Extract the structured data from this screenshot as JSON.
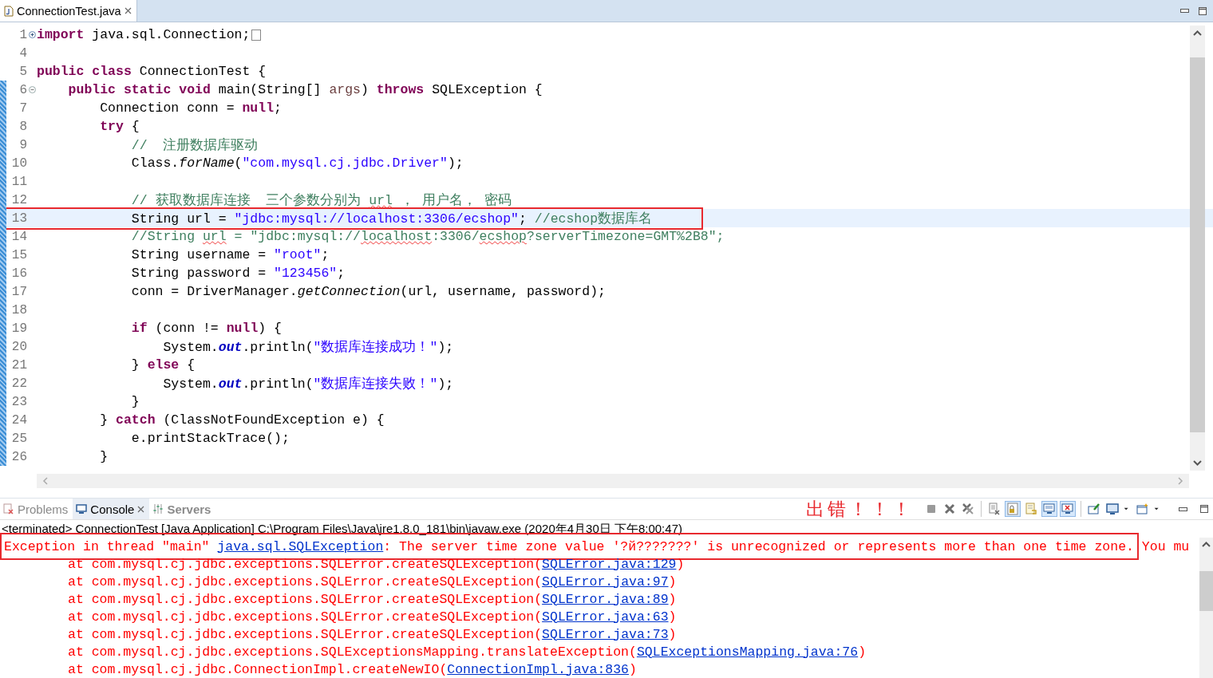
{
  "editor": {
    "tab": {
      "title": "ConnectionTest.java",
      "selected": true
    },
    "lines": [
      {
        "number": "1",
        "expanded": false,
        "folded_box": true,
        "scope": false,
        "current": false,
        "boxed": false,
        "segments": [
          {
            "kind": "keyword",
            "text": "import"
          },
          {
            "kind": "plain",
            "text": " java.sql.Connection;"
          }
        ]
      },
      {
        "number": "4",
        "scope": false,
        "current": false,
        "boxed": false
      },
      {
        "number": "5",
        "scope": false,
        "current": false,
        "boxed": false,
        "segments": [
          {
            "kind": "keyword",
            "text": "public class"
          },
          {
            "kind": "plain",
            "text": " ConnectionTest {"
          }
        ]
      },
      {
        "number": "6",
        "expanded": true,
        "scope": true,
        "current": false,
        "boxed": false,
        "segments": [
          {
            "kind": "keyword",
            "text": "    public static void"
          },
          {
            "kind": "plain",
            "text": " main(String[] "
          },
          {
            "kind": "param",
            "text": "args"
          },
          {
            "kind": "plain",
            "text": ") "
          },
          {
            "kind": "keyword",
            "text": "throws"
          },
          {
            "kind": "plain",
            "text": " SQLException {"
          }
        ]
      },
      {
        "number": "7",
        "scope": true,
        "current": false,
        "boxed": false,
        "segments": [
          {
            "kind": "plain",
            "text": "        Connection conn = "
          },
          {
            "kind": "keyword",
            "text": "null"
          },
          {
            "kind": "plain",
            "text": ";"
          }
        ]
      },
      {
        "number": "8",
        "scope": true,
        "current": false,
        "boxed": false,
        "segments": [
          {
            "kind": "keyword",
            "text": "        try"
          },
          {
            "kind": "plain",
            "text": " {"
          }
        ]
      },
      {
        "number": "9",
        "scope": true,
        "current": false,
        "boxed": false,
        "segments": [
          {
            "kind": "comment",
            "text": "            //  注册数据库驱动"
          }
        ]
      },
      {
        "number": "10",
        "scope": true,
        "current": false,
        "boxed": false,
        "segments": [
          {
            "kind": "plain",
            "text": "            Class."
          },
          {
            "kind": "method",
            "text": "forName"
          },
          {
            "kind": "plain",
            "text": "("
          },
          {
            "kind": "string",
            "text": "\"com.mysql.cj.jdbc.Driver\""
          },
          {
            "kind": "plain",
            "text": ");"
          }
        ]
      },
      {
        "number": "11",
        "scope": true,
        "current": false,
        "boxed": false
      },
      {
        "number": "12",
        "scope": true,
        "current": false,
        "boxed": false,
        "segments": [
          {
            "kind": "comment",
            "text": "            // 获取数据库连接  三个参数分别为 "
          },
          {
            "kind": "comment-squiggle",
            "text": "url"
          },
          {
            "kind": "comment",
            "text": " ， 用户名， 密码"
          }
        ]
      },
      {
        "number": "13",
        "scope": true,
        "current": true,
        "boxed": true,
        "segments": [
          {
            "kind": "plain",
            "text": "            String url = "
          },
          {
            "kind": "string",
            "text": "\"jdbc:mysql://localhost:3306/ecshop\""
          },
          {
            "kind": "plain",
            "text": "; "
          },
          {
            "kind": "comment",
            "text": "//ecshop数据库名"
          }
        ]
      },
      {
        "number": "14",
        "scope": true,
        "current": false,
        "boxed": false,
        "segments": [
          {
            "kind": "comment",
            "text": "            //String "
          },
          {
            "kind": "comment-squiggle",
            "text": "url"
          },
          {
            "kind": "comment",
            "text": " = \"jdbc:mysql://"
          },
          {
            "kind": "comment-squiggle",
            "text": "localhost"
          },
          {
            "kind": "comment",
            "text": ":3306/"
          },
          {
            "kind": "comment-squiggle",
            "text": "ecshop"
          },
          {
            "kind": "comment",
            "text": "?serverTimezone=GMT%2B8\";"
          }
        ]
      },
      {
        "number": "15",
        "scope": true,
        "current": false,
        "boxed": false,
        "segments": [
          {
            "kind": "plain",
            "text": "            String username = "
          },
          {
            "kind": "string",
            "text": "\"root\""
          },
          {
            "kind": "plain",
            "text": ";"
          }
        ]
      },
      {
        "number": "16",
        "scope": true,
        "current": false,
        "boxed": false,
        "segments": [
          {
            "kind": "plain",
            "text": "            String password = "
          },
          {
            "kind": "string",
            "text": "\"123456\""
          },
          {
            "kind": "plain",
            "text": ";"
          }
        ]
      },
      {
        "number": "17",
        "scope": true,
        "current": false,
        "boxed": false,
        "segments": [
          {
            "kind": "plain",
            "text": "            conn = DriverManager."
          },
          {
            "kind": "method",
            "text": "getConnection"
          },
          {
            "kind": "plain",
            "text": "(url, username, password);"
          }
        ]
      },
      {
        "number": "18",
        "scope": true,
        "current": false,
        "boxed": false
      },
      {
        "number": "19",
        "scope": true,
        "current": false,
        "boxed": false,
        "segments": [
          {
            "kind": "keyword",
            "text": "            if"
          },
          {
            "kind": "plain",
            "text": " (conn != "
          },
          {
            "kind": "keyword",
            "text": "null"
          },
          {
            "kind": "plain",
            "text": ") {"
          }
        ]
      },
      {
        "number": "20",
        "scope": true,
        "current": false,
        "boxed": false,
        "segments": [
          {
            "kind": "plain",
            "text": "                System."
          },
          {
            "kind": "field",
            "text": "out"
          },
          {
            "kind": "plain",
            "text": ".println("
          },
          {
            "kind": "string",
            "text": "\"数据库连接成功！\""
          },
          {
            "kind": "plain",
            "text": ");"
          }
        ]
      },
      {
        "number": "21",
        "scope": true,
        "current": false,
        "boxed": false,
        "segments": [
          {
            "kind": "plain",
            "text": "            } "
          },
          {
            "kind": "keyword",
            "text": "else"
          },
          {
            "kind": "plain",
            "text": " {"
          }
        ]
      },
      {
        "number": "22",
        "scope": true,
        "current": false,
        "boxed": false,
        "segments": [
          {
            "kind": "plain",
            "text": "                System."
          },
          {
            "kind": "field",
            "text": "out"
          },
          {
            "kind": "plain",
            "text": ".println("
          },
          {
            "kind": "string",
            "text": "\"数据库连接失败！\""
          },
          {
            "kind": "plain",
            "text": ");"
          }
        ]
      },
      {
        "number": "23",
        "scope": true,
        "current": false,
        "boxed": false,
        "segments": [
          {
            "kind": "plain",
            "text": "            }"
          }
        ]
      },
      {
        "number": "24",
        "scope": true,
        "current": false,
        "boxed": false,
        "segments": [
          {
            "kind": "plain",
            "text": "        } "
          },
          {
            "kind": "keyword",
            "text": "catch"
          },
          {
            "kind": "plain",
            "text": " (ClassNotFoundException e) {"
          }
        ]
      },
      {
        "number": "25",
        "scope": true,
        "current": false,
        "boxed": false,
        "segments": [
          {
            "kind": "plain",
            "text": "            e.printStackTrace();"
          }
        ]
      },
      {
        "number": "26",
        "scope": true,
        "current": false,
        "boxed": false,
        "segments": [
          {
            "kind": "plain",
            "text": "        }"
          }
        ]
      }
    ]
  },
  "panel": {
    "tabs": [
      {
        "kind": "problems",
        "label": "Problems",
        "selected": false,
        "emphasized": false
      },
      {
        "kind": "console",
        "label": "Console",
        "selected": true,
        "emphasized": false
      },
      {
        "kind": "servers",
        "label": "Servers",
        "selected": false,
        "emphasized": true
      }
    ],
    "annotation": "出错！！！",
    "toolbar_groups": [
      {
        "tools": [
          {
            "kind": "terminate",
            "pressed": false
          },
          {
            "kind": "remove",
            "pressed": false
          },
          {
            "kind": "remove-all",
            "pressed": false
          }
        ]
      },
      {
        "tools": [
          {
            "kind": "clear",
            "pressed": false
          },
          {
            "kind": "scroll-lock",
            "pressed": true
          },
          {
            "kind": "word-wrap",
            "pressed": false
          },
          {
            "kind": "show-out",
            "pressed": true
          },
          {
            "kind": "show-err",
            "pressed": true
          }
        ]
      },
      {
        "tools": [
          {
            "kind": "pin",
            "pressed": false
          },
          {
            "kind": "display",
            "pressed": false
          },
          {
            "kind": "dropdown",
            "pressed": false
          },
          {
            "kind": "open-console",
            "pressed": false
          },
          {
            "kind": "dropdown",
            "pressed": false
          }
        ]
      }
    ],
    "console_header": "<terminated> ConnectionTest [Java Application] C:\\Program Files\\Java\\jre1.8.0_181\\bin\\javaw.exe (2020年4月30日 下午8:00:47)",
    "console_lines": [
      {
        "kind": "exception",
        "boxed": true,
        "segments": [
          {
            "kind": "error",
            "text": "Exception in thread \"main\" "
          },
          {
            "kind": "link",
            "text": "java.sql.SQLException"
          },
          {
            "kind": "error",
            "text": ": The server time zone value '?й???????' is unrecognized or represents more than one time zone. You mu"
          }
        ]
      },
      {
        "kind": "stack",
        "boxed": false,
        "segments": [
          {
            "kind": "error",
            "text": "at com.mysql.cj.jdbc.exceptions.SQLError.createSQLException("
          },
          {
            "kind": "link",
            "text": "SQLError.java:129"
          },
          {
            "kind": "error",
            "text": ")"
          }
        ]
      },
      {
        "kind": "stack",
        "boxed": false,
        "segments": [
          {
            "kind": "error",
            "text": "at com.mysql.cj.jdbc.exceptions.SQLError.createSQLException("
          },
          {
            "kind": "link",
            "text": "SQLError.java:97"
          },
          {
            "kind": "error",
            "text": ")"
          }
        ]
      },
      {
        "kind": "stack",
        "boxed": false,
        "segments": [
          {
            "kind": "error",
            "text": "at com.mysql.cj.jdbc.exceptions.SQLError.createSQLException("
          },
          {
            "kind": "link",
            "text": "SQLError.java:89"
          },
          {
            "kind": "error",
            "text": ")"
          }
        ]
      },
      {
        "kind": "stack",
        "boxed": false,
        "segments": [
          {
            "kind": "error",
            "text": "at com.mysql.cj.jdbc.exceptions.SQLError.createSQLException("
          },
          {
            "kind": "link",
            "text": "SQLError.java:63"
          },
          {
            "kind": "error",
            "text": ")"
          }
        ]
      },
      {
        "kind": "stack",
        "boxed": false,
        "segments": [
          {
            "kind": "error",
            "text": "at com.mysql.cj.jdbc.exceptions.SQLError.createSQLException("
          },
          {
            "kind": "link",
            "text": "SQLError.java:73"
          },
          {
            "kind": "error",
            "text": ")"
          }
        ]
      },
      {
        "kind": "stack",
        "boxed": false,
        "segments": [
          {
            "kind": "error",
            "text": "at com.mysql.cj.jdbc.exceptions.SQLExceptionsMapping.translateException("
          },
          {
            "kind": "link",
            "text": "SQLExceptionsMapping.java:76"
          },
          {
            "kind": "error",
            "text": ")"
          }
        ]
      },
      {
        "kind": "stack",
        "boxed": false,
        "segments": [
          {
            "kind": "error",
            "text": "at com.mysql.cj.jdbc.ConnectionImpl.createNewIO("
          },
          {
            "kind": "link",
            "text": "ConnectionImpl.java:836"
          },
          {
            "kind": "error",
            "text": ")"
          }
        ]
      }
    ]
  }
}
